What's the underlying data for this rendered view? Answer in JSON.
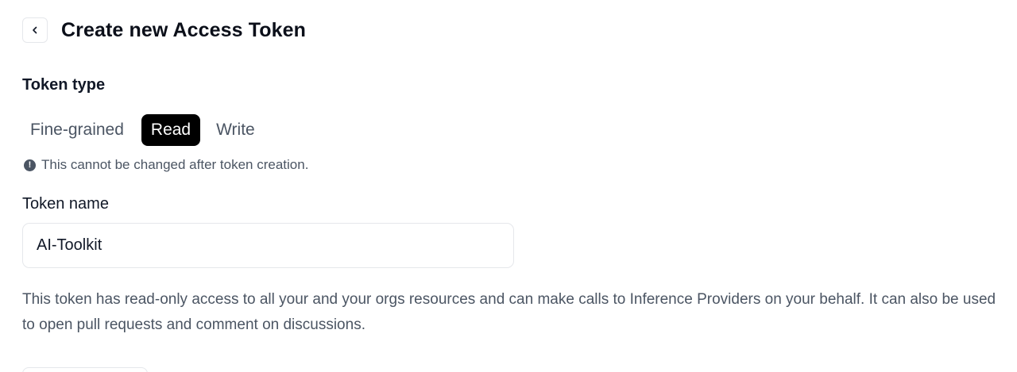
{
  "header": {
    "back_icon": "chevron-left-icon",
    "title": "Create new Access Token"
  },
  "token_type": {
    "label": "Token type",
    "options": [
      "Fine-grained",
      "Read",
      "Write"
    ],
    "selected": "Read",
    "notice": "This cannot be changed after token creation.",
    "notice_icon": "exclamation-circle-icon"
  },
  "token_name": {
    "label": "Token name",
    "value": "AI-Toolkit"
  },
  "description": "This token has read-only access to all your and your orgs resources and can make calls to Inference Providers on your behalf. It can also be used to open pull requests and comment on discussions.",
  "colors": {
    "selected_bg": "#000000",
    "selected_text": "#ffffff",
    "muted_text": "#4b5563"
  }
}
